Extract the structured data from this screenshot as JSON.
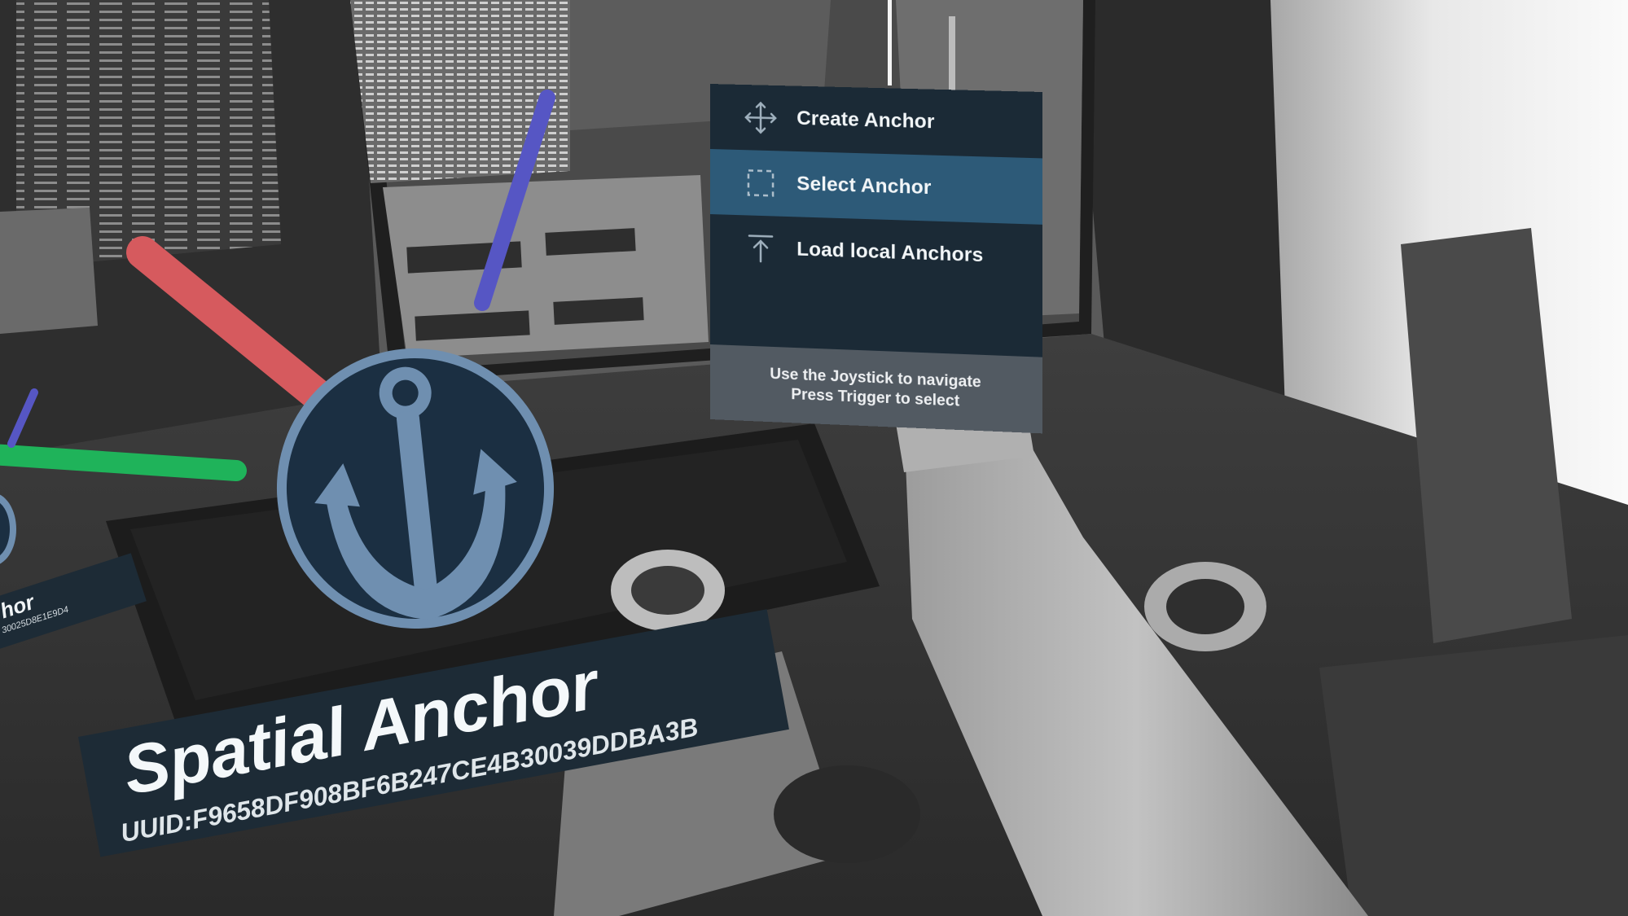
{
  "menu": {
    "items": [
      {
        "label": "Create Anchor",
        "icon": "move-icon",
        "selected": false
      },
      {
        "label": "Select Anchor",
        "icon": "select-icon",
        "selected": true
      },
      {
        "label": "Load local Anchors",
        "icon": "upload-icon",
        "selected": false
      }
    ],
    "help_line_1": "Use the Joystick to navigate",
    "help_line_2": "Press Trigger to select"
  },
  "anchor": {
    "title": "Spatial Anchor",
    "uuid": "UUID:F9658DF908BF6B247CE4B30039DDBA3B",
    "icon": "anchor-icon"
  },
  "secondary_anchor": {
    "title": "hor",
    "uuid": "30025D8E1E9D4"
  },
  "colors": {
    "menu_bg": "#1b2a36",
    "menu_selected": "#2d5a78",
    "menu_footer": "#525a62",
    "axis_x": "#d65a5e",
    "axis_y": "#5656c4",
    "axis_z": "#1fb35a",
    "anchor_disc": "#1b2f42",
    "anchor_symbol": "#6f8fb0"
  }
}
